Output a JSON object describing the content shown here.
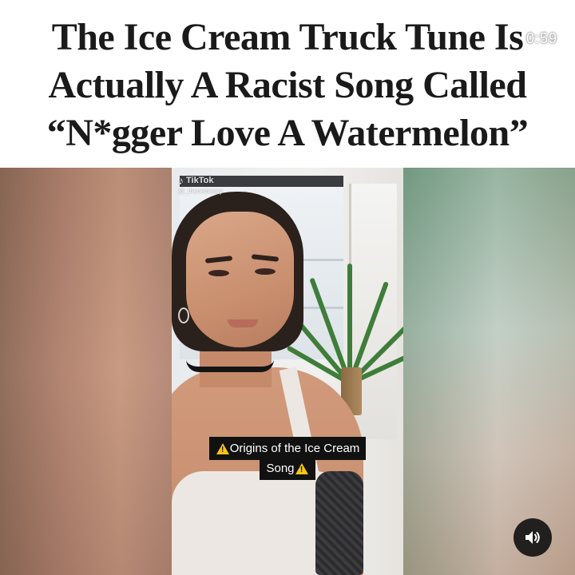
{
  "headline": {
    "lines": [
      "The Ice Cream Truck Tune Is",
      "Actually A Racist Song Called",
      "“N*gger Love A Watermelon”"
    ]
  },
  "video": {
    "timer": "0:59",
    "watermark": {
      "brand": "TikTok",
      "handle": "@_thenetnessy"
    },
    "caption": {
      "line1": "Origins of the Ice Cream",
      "line2": "Song"
    },
    "sound_button": {
      "icon": "speaker-icon",
      "state": "sound-on"
    }
  },
  "colors": {
    "headline_text": "#1a1a1a",
    "caption_bg": "#111111",
    "caption_text": "#ffffff",
    "warning_icon": "#f5c518",
    "sound_button_bg": "#141414"
  }
}
